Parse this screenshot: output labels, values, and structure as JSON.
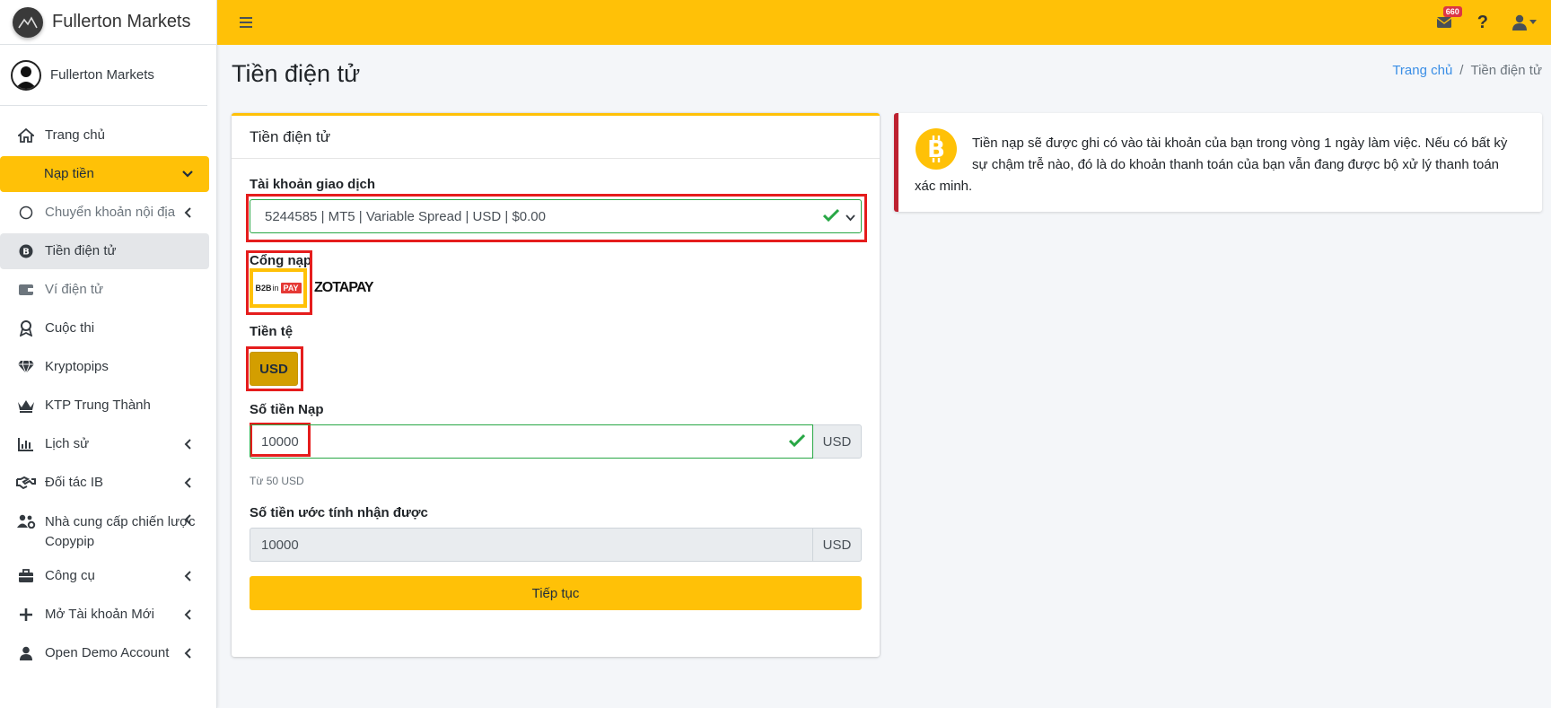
{
  "brand": {
    "name": "Fullerton Markets"
  },
  "user": {
    "name": "Fullerton Markets"
  },
  "sidebar": {
    "items": [
      {
        "label": "Trang chủ"
      },
      {
        "label": "Nạp tiền"
      },
      {
        "label": "Chuyển khoản nội địa"
      },
      {
        "label": "Tiền điện tử"
      },
      {
        "label": "Ví điện tử"
      },
      {
        "label": "Cuộc thi"
      },
      {
        "label": "Kryptopips"
      },
      {
        "label": "KTP Trung Thành"
      },
      {
        "label": "Lịch sử"
      },
      {
        "label": "Đối tác IB"
      },
      {
        "label": "Nhà cung cấp chiến lược Copypip"
      },
      {
        "label": "Công cụ"
      },
      {
        "label": "Mở Tài khoản Mới"
      },
      {
        "label": "Open Demo Account"
      }
    ]
  },
  "topbar": {
    "mail_badge": "660",
    "help": "?"
  },
  "header": {
    "title": "Tiền điện tử",
    "breadcrumb_home": "Trang chủ",
    "breadcrumb_sep": "/",
    "breadcrumb_current": "Tiền điện tử"
  },
  "form": {
    "card_title": "Tiền điện tử",
    "account_label": "Tài khoản giao dịch",
    "account_value": "5244585 | MT5 | Variable Spread | USD | $0.00",
    "gateway_label": "Cổng nạp",
    "gateway_b2b": "B2B",
    "gateway_b2b_in": "in",
    "gateway_b2b_pay": "PAY",
    "gateway_zota": "ZOTAPAY",
    "currency_label": "Tiền tệ",
    "currency_value": "USD",
    "amount_label": "Số tiền Nạp",
    "amount_value": "10000",
    "amount_unit": "USD",
    "amount_hint": "Từ 50 USD",
    "estimate_label": "Số tiền ước tính nhận được",
    "estimate_value": "10000",
    "estimate_unit": "USD",
    "continue_label": "Tiếp tục"
  },
  "notice": {
    "text": "Tiền nạp sẽ được ghi có vào tài khoản của bạn trong vòng 1 ngày làm việc. Nếu có bất kỳ sự chậm trễ nào, đó là do khoản thanh toán của bạn vẫn đang được bộ xử lý thanh toán xác minh."
  },
  "colors": {
    "accent": "#ffc107",
    "success": "#28a745",
    "danger": "#bd2130",
    "highlight": "#e51d1d"
  }
}
